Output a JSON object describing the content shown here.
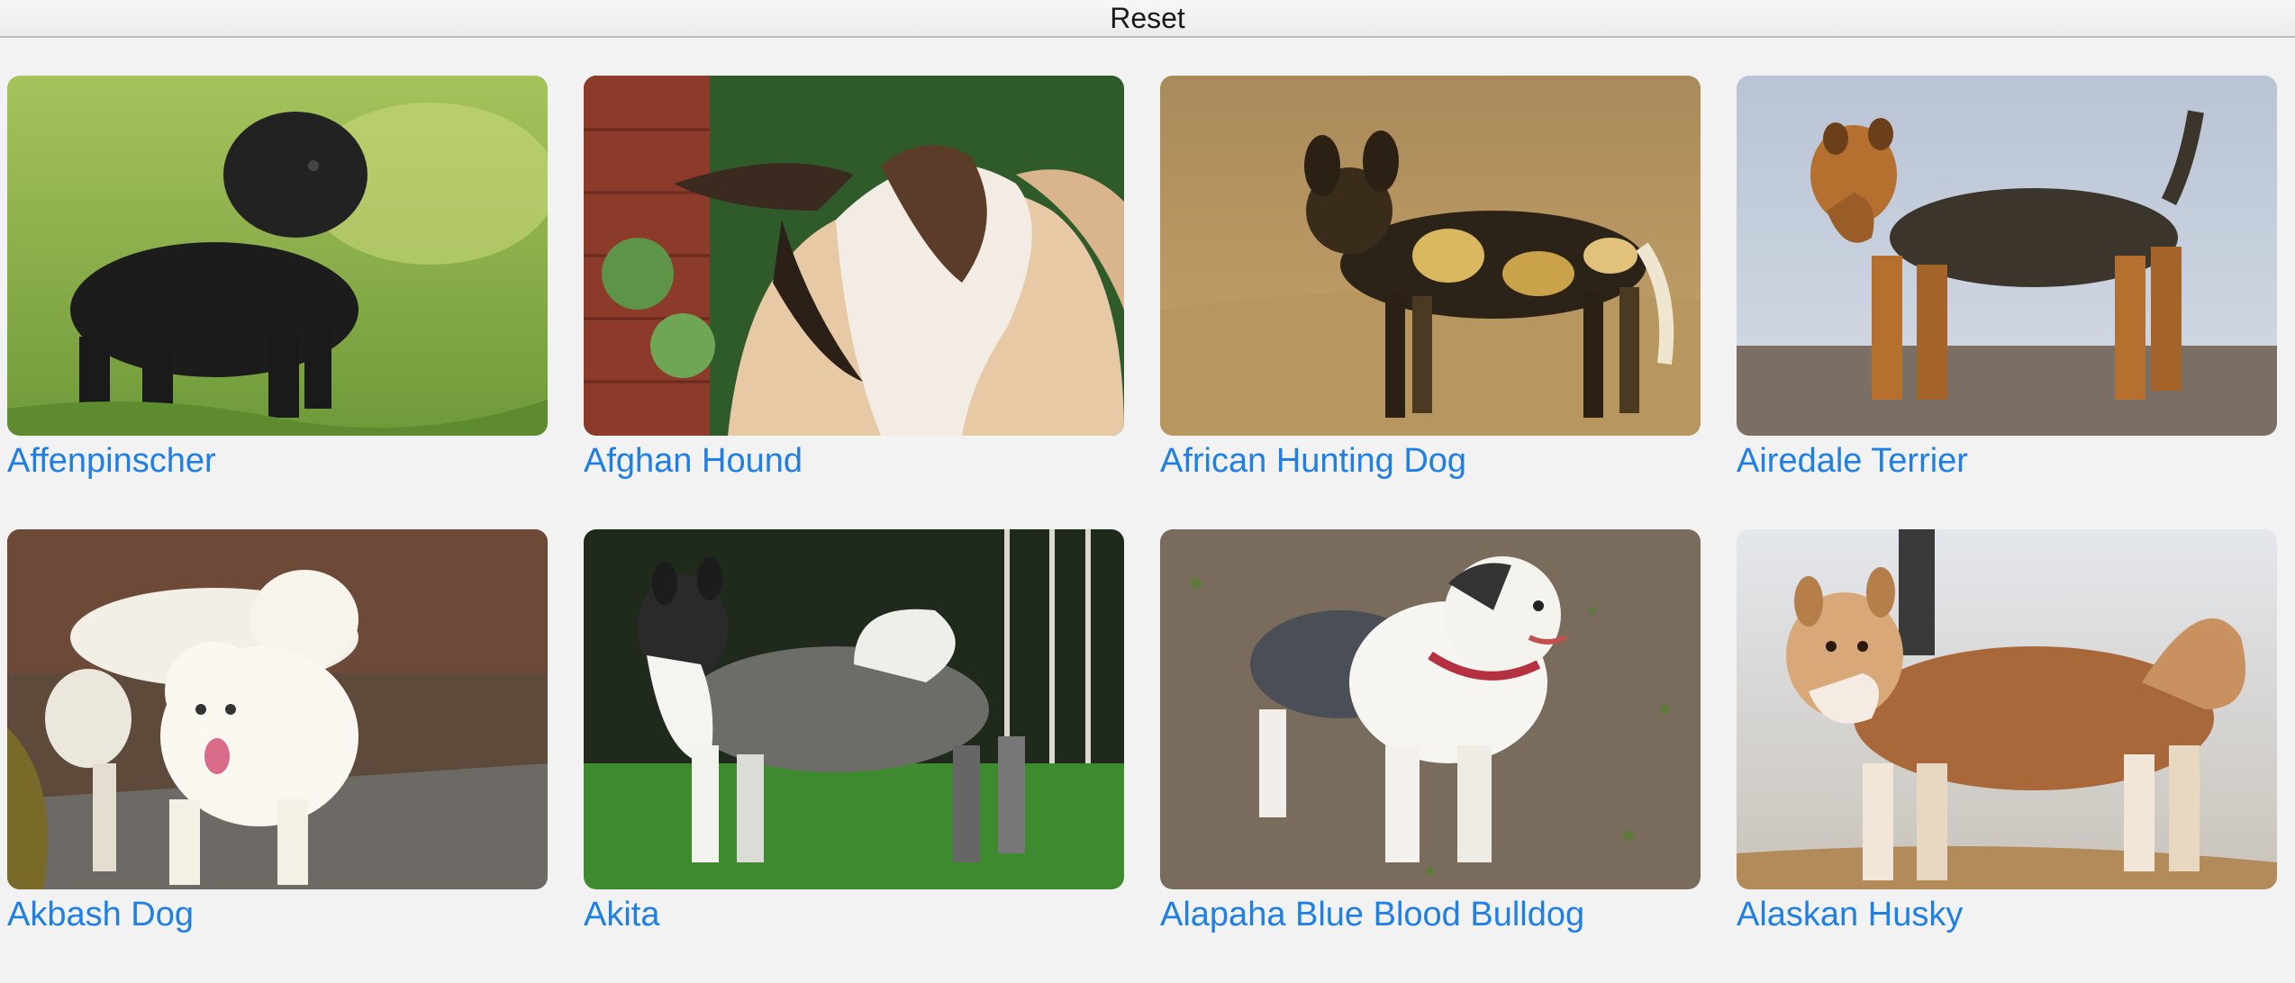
{
  "toolbar": {
    "reset_label": "Reset"
  },
  "breeds": [
    {
      "name": "Affenpinscher",
      "photo": "affenpinscher-photo"
    },
    {
      "name": "Afghan Hound",
      "photo": "afghan-hound-photo"
    },
    {
      "name": "African Hunting Dog",
      "photo": "african-hunting-dog-photo"
    },
    {
      "name": "Airedale Terrier",
      "photo": "airedale-terrier-photo"
    },
    {
      "name": "Akbash Dog",
      "photo": "akbash-dog-photo"
    },
    {
      "name": "Akita",
      "photo": "akita-photo"
    },
    {
      "name": "Alapaha Blue Blood Bulldog",
      "photo": "alapaha-blue-blood-bulldog-photo"
    },
    {
      "name": "Alaskan Husky",
      "photo": "alaskan-husky-photo"
    }
  ],
  "colors": {
    "link": "#1f7fe3",
    "background": "#f2f2f2"
  }
}
